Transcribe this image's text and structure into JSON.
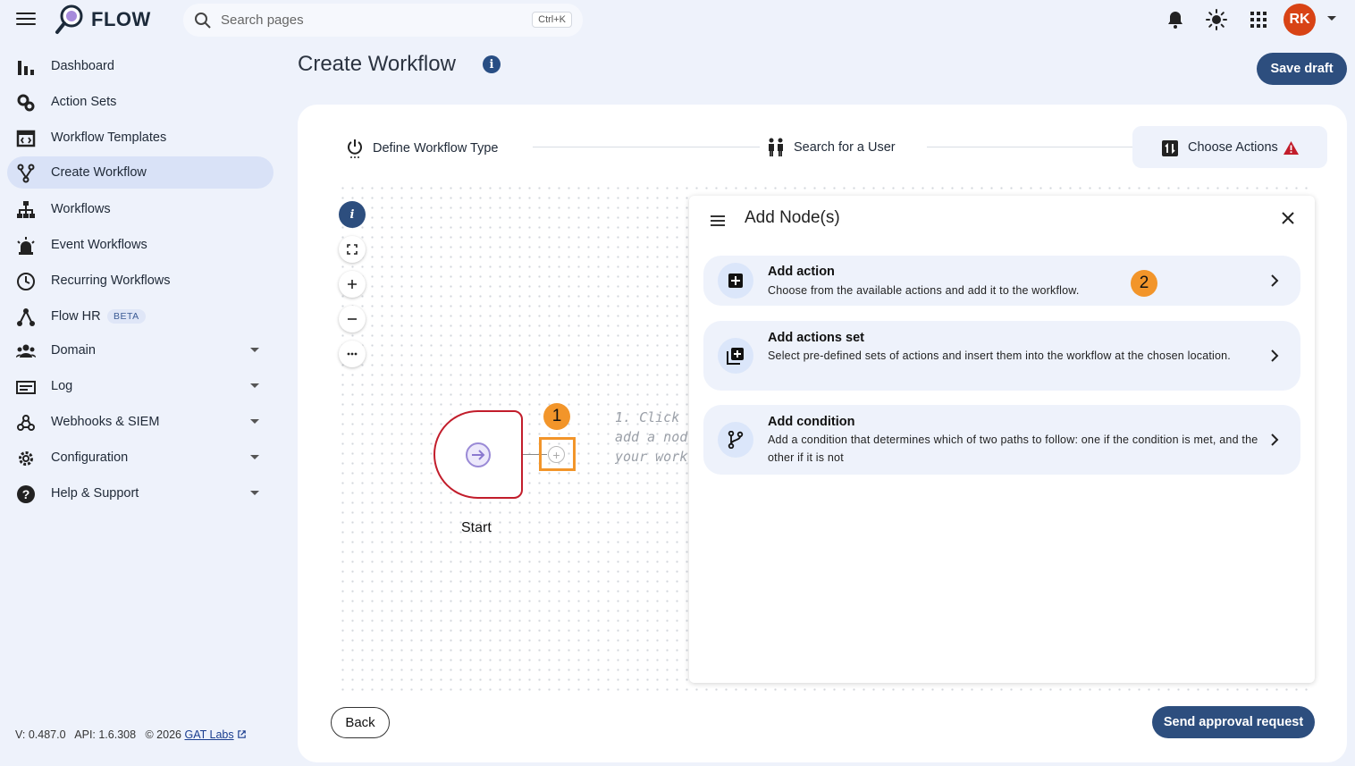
{
  "app": {
    "name": "FLOW"
  },
  "search": {
    "placeholder": "Search pages",
    "shortcut": "Ctrl+K"
  },
  "user": {
    "initials": "RK"
  },
  "sidebar": {
    "items": [
      {
        "label": "Dashboard",
        "icon": "bar-chart-icon"
      },
      {
        "label": "Action Sets",
        "icon": "cogs-icon"
      },
      {
        "label": "Workflow Templates",
        "icon": "template-icon"
      },
      {
        "label": "Create Workflow",
        "icon": "fork-icon",
        "active": true
      },
      {
        "label": "Workflows",
        "icon": "sitemap-icon"
      },
      {
        "label": "Event Workflows",
        "icon": "alarm-light-icon"
      },
      {
        "label": "Recurring Workflows",
        "icon": "clock-icon"
      },
      {
        "label": "Flow HR",
        "icon": "hr-tree-icon",
        "badge": "BETA"
      },
      {
        "label": "Domain",
        "icon": "users-icon",
        "expandable": true
      },
      {
        "label": "Log",
        "icon": "log-icon",
        "expandable": true
      },
      {
        "label": "Webhooks & SIEM",
        "icon": "webhook-icon",
        "expandable": true
      },
      {
        "label": "Configuration",
        "icon": "gear-icon",
        "expandable": true
      },
      {
        "label": "Help & Support",
        "icon": "help-icon",
        "expandable": true
      }
    ],
    "footer": {
      "version": "V: 0.487.0",
      "api": "API: 1.6.308",
      "copyright": "© 2026",
      "company": "GAT Labs"
    }
  },
  "page": {
    "title": "Create Workflow",
    "save_label": "Save draft"
  },
  "stepper": {
    "steps": [
      {
        "label": "Define Workflow Type"
      },
      {
        "label": "Search for a User"
      },
      {
        "label": "Choose Actions"
      }
    ]
  },
  "canvas": {
    "start_label": "Start",
    "hint_lines": [
      "1. Click",
      "add a node",
      "your workf"
    ],
    "markers": [
      "1",
      "2"
    ]
  },
  "panel": {
    "title": "Add Node(s)",
    "options": [
      {
        "title": "Add action",
        "desc": "Choose from the available actions and add it to the workflow."
      },
      {
        "title": "Add actions set",
        "desc": "Select pre-defined sets of actions and insert them into the workflow at the chosen location."
      },
      {
        "title": "Add condition",
        "desc": "Add a condition that determines which of two paths to follow: one if the condition is met, and the other if it is not"
      }
    ]
  },
  "footer_buttons": {
    "back": "Back",
    "send": "Send approval request"
  },
  "colors": {
    "primary": "#2d4e7e",
    "accent": "#f2952a",
    "danger": "#c21d2b",
    "avatar": "#d84315"
  }
}
